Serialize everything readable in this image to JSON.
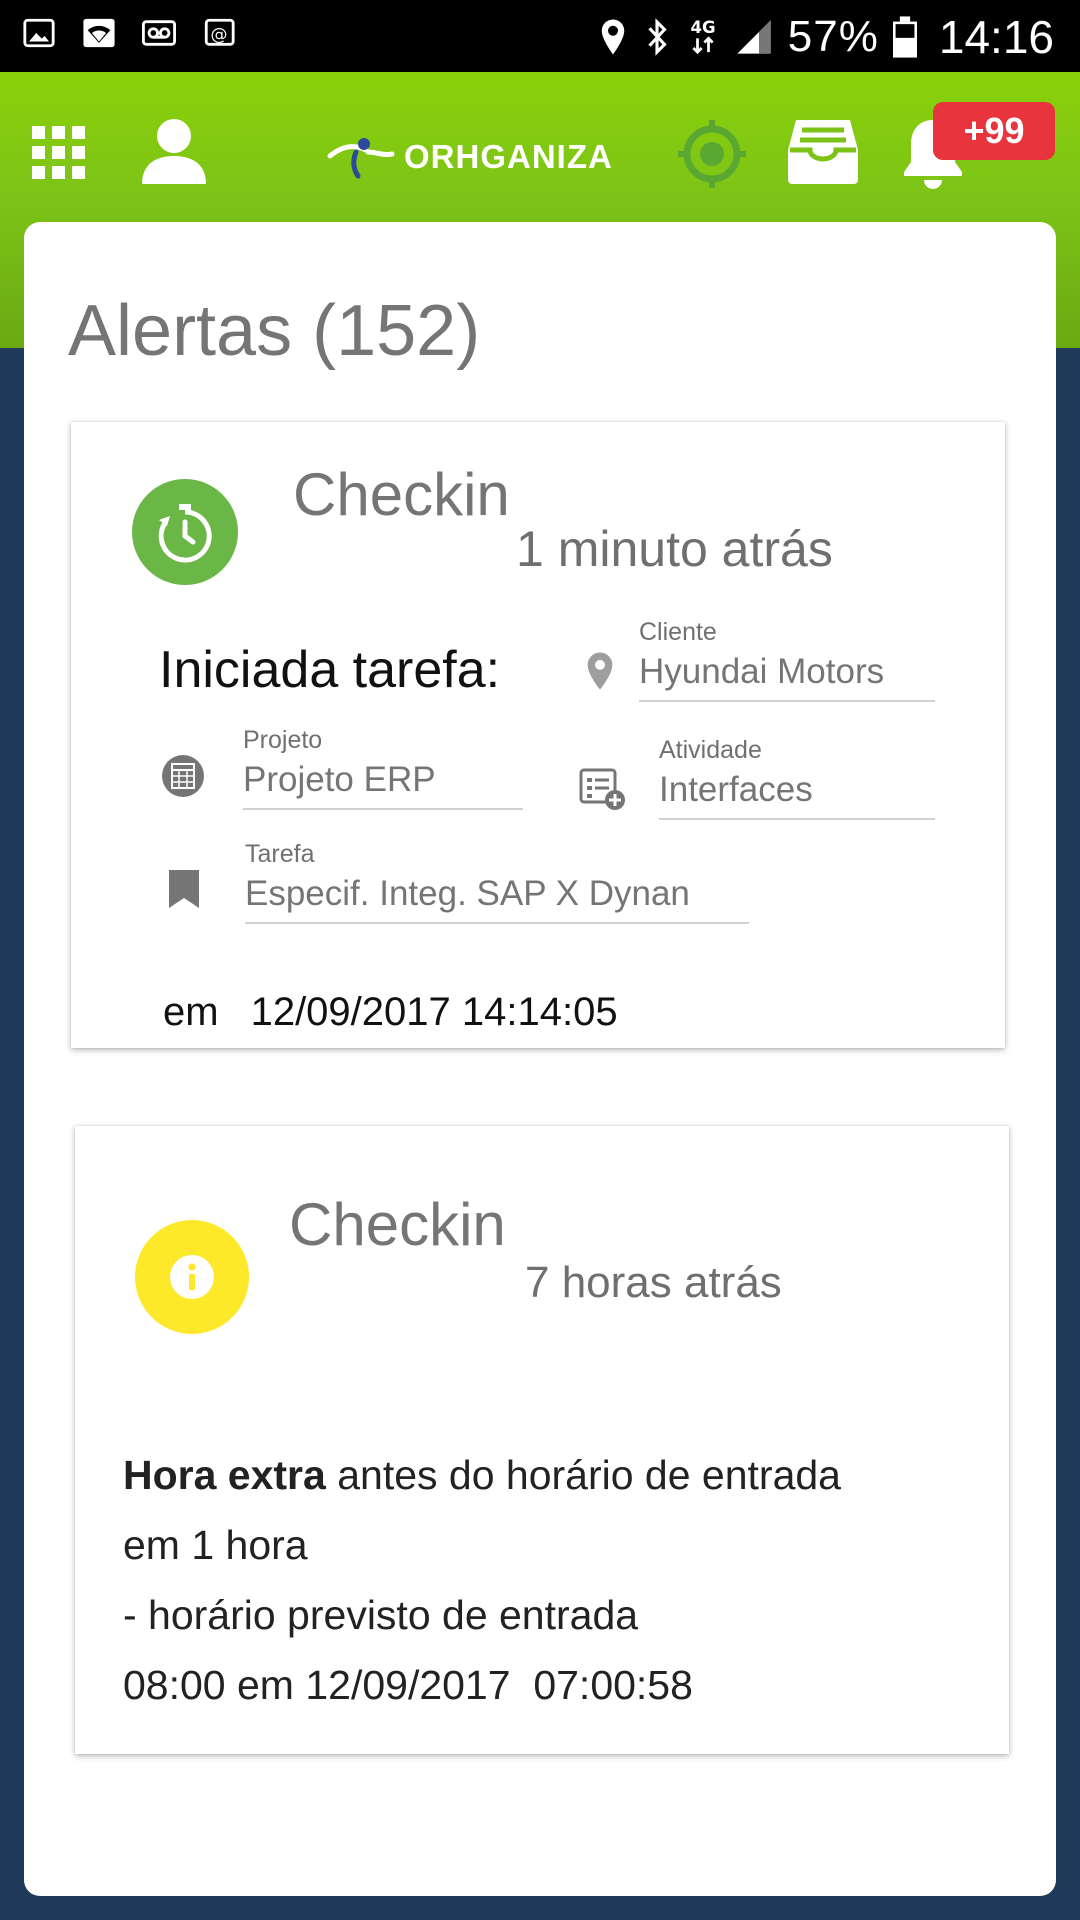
{
  "status_bar": {
    "left_icons": [
      "image-icon",
      "wifi-icon",
      "voicemail-icon",
      "cast-icon"
    ],
    "right_icons": [
      "location-icon",
      "bluetooth-icon",
      "network-4g-icon",
      "signal-icon"
    ],
    "battery": "57%",
    "time": "14:16"
  },
  "header": {
    "logo_text": "ORHGANIZA",
    "notification_badge": "+99",
    "colors": {
      "header_green": "#7dc317",
      "badge_red": "#e8343c",
      "target_icon": "#5aa832"
    }
  },
  "page": {
    "title": "Alertas (152)"
  },
  "alerts": [
    {
      "type": "Checkin",
      "time_ago": "1 minuto atrás",
      "icon": "stopwatch-icon",
      "icon_color": "#6ab747",
      "lead": "Iniciada tarefa:",
      "fields": {
        "cliente": {
          "label": "Cliente",
          "value": "Hyundai Motors"
        },
        "projeto": {
          "label": "Projeto",
          "value": "Projeto ERP"
        },
        "atividade": {
          "label": "Atividade",
          "value": "Interfaces"
        },
        "tarefa": {
          "label": "Tarefa",
          "value": "Especif. Integ. SAP X Dynan"
        }
      },
      "em_label": "em",
      "datetime": "12/09/2017 14:14:05"
    },
    {
      "type": "Checkin",
      "time_ago": "7 horas atrás",
      "icon": "info-icon",
      "icon_color": "#fde829",
      "message_bold": "Hora extra",
      "message_rest": " antes do horário de entrada",
      "line2": "em 1 hora",
      "line3": "- horário previsto de entrada",
      "line4": "08:00 em 12/09/2017  07:00:58"
    }
  ]
}
